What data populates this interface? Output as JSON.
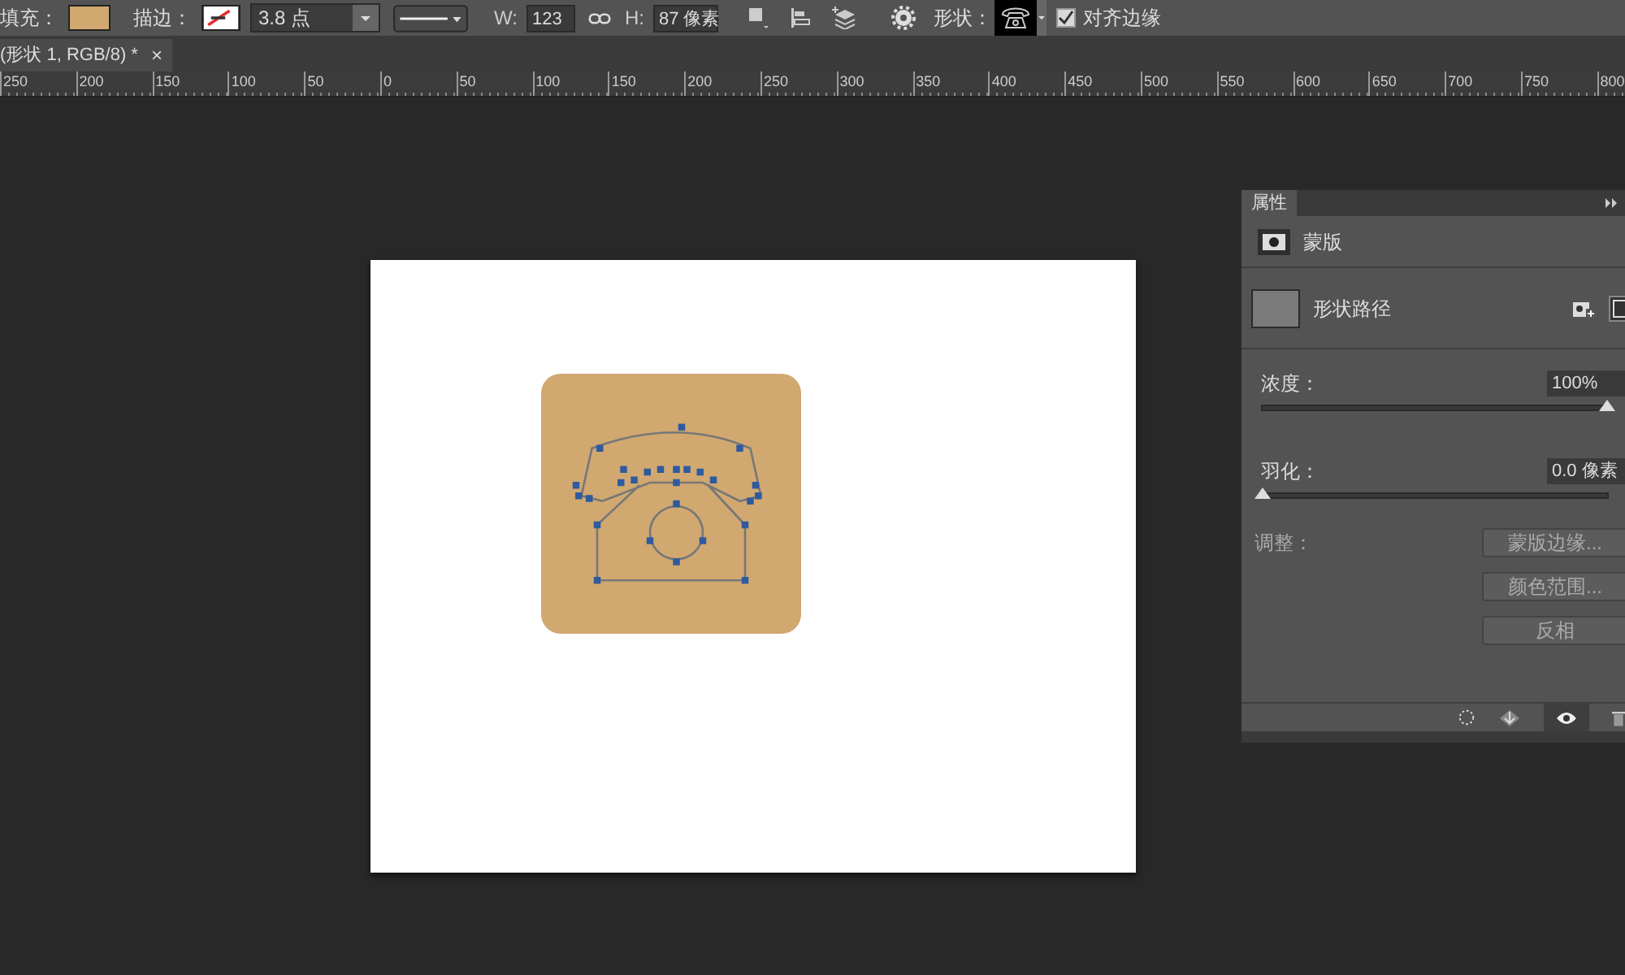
{
  "options_bar": {
    "fill_label": "填充：",
    "stroke_label": "描边：",
    "stroke_width": "3.8 点",
    "width_label": "W:",
    "width_value": "123",
    "height_label": "H:",
    "height_value": "87 像素",
    "shape_label": "形状：",
    "align_edges": {
      "label": "对齐边缘",
      "checked": true
    }
  },
  "document_tab": {
    "title": "(形状 1, RGB/8) *",
    "close": "×"
  },
  "ruler": {
    "labels": [
      "250",
      "200",
      "150",
      "100",
      "50",
      "0",
      "50",
      "100",
      "150",
      "200",
      "250",
      "300",
      "350",
      "400",
      "450",
      "500",
      "550",
      "600",
      "650",
      "700",
      "750",
      "800"
    ]
  },
  "properties_panel": {
    "tab": "属性",
    "mask_label": "蒙版",
    "path_label": "形状路径",
    "density": {
      "label": "浓度：",
      "value": "100%",
      "level": 1
    },
    "feather": {
      "label": "羽化：",
      "value": "0.0 像素",
      "level": 0
    },
    "adjust_label": "调整：",
    "buttons": [
      {
        "label": "蒙版边缘...",
        "disabled": true
      },
      {
        "label": "颜色范围...",
        "disabled": true
      },
      {
        "label": "反相",
        "disabled": true
      }
    ]
  }
}
